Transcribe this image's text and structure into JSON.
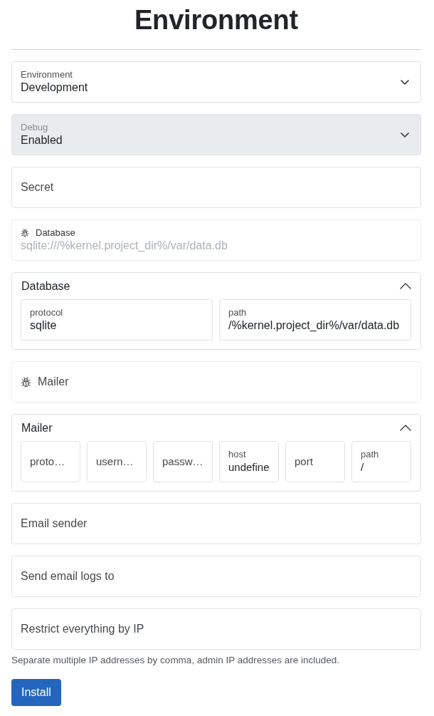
{
  "title": "Environment",
  "fields": [
    {
      "kind": "select",
      "label": "Environment",
      "value": "Development",
      "disabled": false
    },
    {
      "kind": "select",
      "label": "Debug",
      "value": "Enabled",
      "disabled": true
    },
    {
      "kind": "input",
      "placeholder": "Secret"
    },
    {
      "kind": "dsn",
      "label": "Database",
      "placeholder": "sqlite:///%kernel.project_dir%/var/data.db"
    },
    {
      "kind": "group",
      "title": "Database",
      "expanded": true,
      "fields": [
        {
          "label": "protocol",
          "value": "sqlite"
        },
        {
          "label": "path",
          "value": "/%kernel.project_dir%/var/data.db"
        }
      ]
    },
    {
      "kind": "dsn",
      "label": "Mailer"
    },
    {
      "kind": "group",
      "title": "Mailer",
      "expanded": true,
      "fields": [
        {
          "placeholder": "proto…"
        },
        {
          "placeholder": "usern…"
        },
        {
          "placeholder": "passw…"
        },
        {
          "label": "host",
          "value": "undefine"
        },
        {
          "placeholder": "port"
        },
        {
          "label": "path",
          "value": "/"
        }
      ]
    },
    {
      "kind": "input",
      "placeholder": "Email sender"
    },
    {
      "kind": "input",
      "placeholder": "Send email logs to"
    },
    {
      "kind": "input",
      "placeholder": "Restrict everything by IP",
      "help": "Separate multiple IP addresses by comma, admin IP addresses are included."
    }
  ],
  "button": "Install"
}
